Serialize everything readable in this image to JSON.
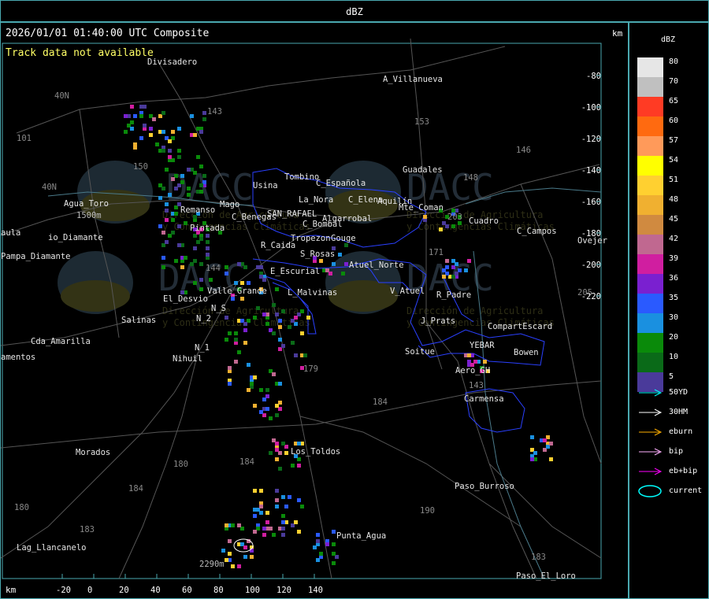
{
  "window_title": "dBZ",
  "header": {
    "timestamp": "2026/01/01 01:40:00 UTC Composite",
    "warning": "Track data not available",
    "units_top": "km",
    "units_bottom": "km"
  },
  "axes": {
    "x_ticks": [
      "-20",
      "0",
      "20",
      "40",
      "60",
      "80",
      "100",
      "120",
      "140"
    ],
    "y_ticks": [
      "-80",
      "-100",
      "-120",
      "-140",
      "-160",
      "-180",
      "-200",
      "-220"
    ]
  },
  "map_labels": {
    "divisadero": "Divisadero",
    "villanueva": "A_Villanueva",
    "guadales": "Guadales",
    "tombino": "Tombino",
    "usina": "Usina",
    "la_nora": "La_Nora",
    "c_espanola": "C_Española",
    "aqua_toro": "Agua_Toro",
    "remanso": "Remanso",
    "mago": "Mago",
    "benegas": "C_Benegas",
    "san_rafael": "SAN_RAFAEL",
    "algarrobal": "Algarrobal",
    "c_elena": "C_Elena",
    "aquilin": "Aquilín",
    "mte_coman": "Mte_Coman",
    "pintada": "Pintada",
    "bombal": "C_Bombal",
    "tropezon": "Tropezon",
    "gouge": "Gouge",
    "goudge2": "C_Campos",
    "cuadro": "Cuadro",
    "ovejeria": "Ovejer",
    "aula": "aula",
    "pampa_diamante": "Pampa_Diamante",
    "diamante": "io_Diamante",
    "r_caida": "R_Caida",
    "s_rosas": "S_Rosas",
    "atuel_norte": "Atuel_Norte",
    "escurial": "E_Escurial",
    "el_desvio": "El_Desvio",
    "valle_grande": "Valle_Grande",
    "malvinas": "L_Malvinas",
    "v_atuel": "V_Atuel",
    "r_padre": "R_Padre",
    "salinas": "Salinas",
    "n5": "N_S",
    "n2": "N_2",
    "j_prats": "J_Prats",
    "compart": "CompartEscard",
    "cda_amarilla": "Cda_Amarilla",
    "n1": "N_1",
    "nihuil": "Nihuil",
    "yebar": "YEBAR",
    "soitue": "Soitue",
    "bowen": "Bowen",
    "amentos": "amentos",
    "aero_gh": "Aero_GH",
    "carmensa": "Carmensa",
    "morados": "Morados",
    "los_toldos": "Los_Toldos",
    "paso_burroso": "Paso_Burroso",
    "lag_llancanelo": "Lag_Llancanelo",
    "punta_agua": "Punta_Agua",
    "paso_el_loro": "Paso_El_Loro",
    "elev_2290": "2290m",
    "elev_1500": "1500m",
    "n40": "40N",
    "n40b": "40N",
    "r101": "101",
    "r143": "143",
    "r153": "153",
    "r146": "146",
    "r148": "148",
    "r150": "150",
    "r203": "203",
    "r144": "144",
    "r179": "179",
    "r184": "184",
    "r180": "180",
    "r183": "183",
    "r190": "190",
    "r205": "205",
    "r171": "171",
    "r143b": "143",
    "r184b": "184",
    "r184c": "184",
    "r183b": "183",
    "r180b": "180"
  },
  "watermark": {
    "brand": "DACC",
    "line1": "Dirección de Agricultura",
    "line2": "y Contingencias Climáticas"
  },
  "legend": {
    "title": "dBZ",
    "scale": [
      {
        "label": "80",
        "color": "#e6e6e6"
      },
      {
        "label": "70",
        "color": "#c0c0c0"
      },
      {
        "label": "65",
        "color": "#ff3b24"
      },
      {
        "label": "60",
        "color": "#ff6a10"
      },
      {
        "label": "57",
        "color": "#ff9a5a"
      },
      {
        "label": "54",
        "color": "#ffff00"
      },
      {
        "label": "51",
        "color": "#ffd030"
      },
      {
        "label": "48",
        "color": "#f0b030"
      },
      {
        "label": "45",
        "color": "#d08a40"
      },
      {
        "label": "42",
        "color": "#c06890"
      },
      {
        "label": "39",
        "color": "#d01ea0"
      },
      {
        "label": "36",
        "color": "#7a20d0"
      },
      {
        "label": "35",
        "color": "#2a5aff"
      },
      {
        "label": "30",
        "color": "#1a90e0"
      },
      {
        "label": "20",
        "color": "#0a8a0a"
      },
      {
        "label": "10",
        "color": "#0a6a18"
      },
      {
        "label": "5",
        "color": "#4a3a9a"
      }
    ],
    "tracks": [
      {
        "label": "50YD",
        "color": "#00ffff"
      },
      {
        "label": "30HM",
        "color": "#ffffff"
      },
      {
        "label": "eburn",
        "color": "#ffb000"
      },
      {
        "label": "bip",
        "color": "#ffb0ff"
      },
      {
        "label": "eb+bip",
        "color": "#ff00ff"
      },
      {
        "label": "current",
        "color": "#00ffff"
      }
    ]
  }
}
